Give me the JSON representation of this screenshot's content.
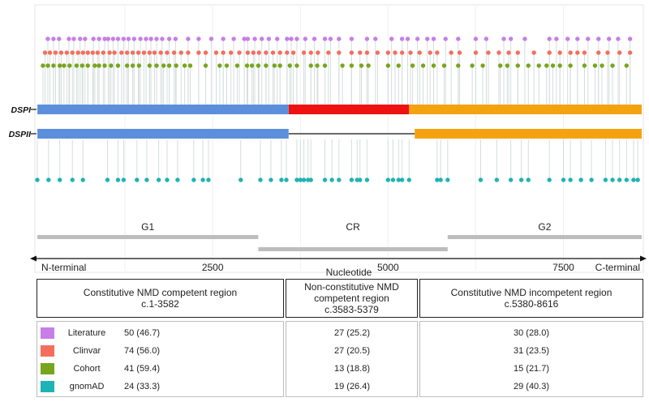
{
  "chart_data": {
    "type": "lollipop",
    "x_axis": {
      "label": "Nucleotide",
      "ticks": [
        2500,
        5000,
        7500
      ],
      "range": [
        0,
        8616
      ],
      "left_label": "N-terminal",
      "right_label": "C-terminal"
    },
    "isoforms": [
      {
        "name": "DSPI",
        "segments": [
          {
            "start": 1,
            "end": 3582,
            "color": "#5b8fdc"
          },
          {
            "start": 3583,
            "end": 5300,
            "color": "#ee1111"
          },
          {
            "start": 5300,
            "end": 8616,
            "color": "#f5a211"
          }
        ]
      },
      {
        "name": "DSPII",
        "segments": [
          {
            "start": 1,
            "end": 3582,
            "color": "#5b8fdc"
          },
          {
            "start": 5380,
            "end": 8616,
            "color": "#f5a211"
          }
        ],
        "gap": {
          "start": 3582,
          "end": 5380
        }
      }
    ],
    "regions": [
      {
        "name": "G1",
        "start": 0,
        "end": 3150
      },
      {
        "name": "CR",
        "start": 3150,
        "end": 5850
      },
      {
        "name": "G2",
        "start": 5850,
        "end": 8616
      }
    ],
    "series": [
      {
        "name": "Literature",
        "color": "#c77ee8",
        "positions": [
          150,
          230,
          310,
          450,
          520,
          610,
          680,
          800,
          880,
          960,
          1010,
          1080,
          1150,
          1230,
          1300,
          1380,
          1470,
          1550,
          1620,
          1700,
          1780,
          1880,
          1970,
          2150,
          2300,
          2480,
          2650,
          2800,
          2950,
          3000,
          3100,
          3200,
          3300,
          3420,
          3560,
          3620,
          3700,
          3820,
          3950,
          4100,
          4180,
          4300,
          4480,
          4700,
          4820,
          5050,
          5200,
          5280,
          5420,
          5560,
          5650,
          5820,
          6000,
          6250,
          6400,
          6650,
          6750,
          6950,
          7300,
          7400,
          7560,
          7700,
          7850,
          8000,
          8150,
          8280,
          8450
        ]
      },
      {
        "name": "Clinvar",
        "color": "#f46e5e",
        "positions": [
          110,
          180,
          260,
          340,
          420,
          500,
          580,
          650,
          720,
          790,
          860,
          940,
          1030,
          1100,
          1200,
          1280,
          1360,
          1440,
          1520,
          1600,
          1670,
          1760,
          1850,
          1950,
          2050,
          2150,
          2300,
          2400,
          2550,
          2650,
          2760,
          2880,
          3000,
          3080,
          3160,
          3260,
          3360,
          3460,
          3560,
          3650,
          3800,
          3900,
          4000,
          4150,
          4300,
          4480,
          4600,
          4700,
          4850,
          5000,
          5100,
          5200,
          5320,
          5450,
          5600,
          5700,
          5900,
          6020,
          6250,
          6430,
          6580,
          6720,
          6850,
          7080,
          7300,
          7450,
          7600,
          7700,
          7800,
          8000,
          8130,
          8300,
          8450
        ]
      },
      {
        "name": "Cohort",
        "color": "#78a51e",
        "positions": [
          80,
          150,
          230,
          320,
          380,
          460,
          560,
          640,
          720,
          820,
          880,
          960,
          1050,
          1150,
          1280,
          1360,
          1450,
          1600,
          1700,
          1800,
          1880,
          1980,
          2100,
          2180,
          2400,
          2600,
          2700,
          2850,
          2990,
          3060,
          3150,
          3260,
          3380,
          3460,
          3600,
          3700,
          3900,
          3990,
          4100,
          4350,
          4480,
          4620,
          4720,
          5000,
          5150,
          5350,
          5500,
          5650,
          5800,
          6000,
          6200,
          6350,
          6600,
          6700,
          6850,
          7000,
          7150,
          7260,
          7350,
          7450,
          7600,
          7800,
          7950,
          8050,
          8200,
          8400
        ]
      },
      {
        "name": "gnomAD",
        "color": "#1fb3b3",
        "positions": [
          0,
          160,
          320,
          500,
          650,
          1000,
          1150,
          1230,
          1420,
          1560,
          1730,
          1850,
          2000,
          2230,
          2360,
          2440,
          2900,
          3180,
          3330,
          3480,
          3550,
          3700,
          3750,
          3800,
          3860,
          3900,
          4100,
          4200,
          4300,
          4480,
          4560,
          4600,
          4700,
          5000,
          5070,
          5150,
          5200,
          5300,
          5700,
          5750,
          5850,
          6320,
          6550,
          6750,
          6900,
          7000,
          7300,
          7500,
          7600,
          7750,
          7900,
          8100,
          8200,
          8300,
          8400,
          8500,
          8560
        ]
      }
    ],
    "region_boxes": [
      {
        "title": "Constitutive NMD competent region",
        "range": "c.1-3582",
        "color": "#6a9ad8"
      },
      {
        "title_lines": [
          "Non-constitutive NMD",
          "competent region"
        ],
        "range": "c.3583-5379",
        "color": "#e0202a"
      },
      {
        "title": "Constitutive NMD incompetent region",
        "range": "c.5380-8616",
        "color": "#f2b233"
      }
    ],
    "table": {
      "rows": [
        {
          "label": "Literature",
          "color": "#c77ee8",
          "values": [
            "50 (46.7)",
            "27 (25.2)",
            "30 (28.0)"
          ]
        },
        {
          "label": "Clinvar",
          "color": "#f46e5e",
          "values": [
            "74 (56.0)",
            "27 (20.5)",
            "31 (23.5)"
          ]
        },
        {
          "label": "Cohort",
          "color": "#78a51e",
          "values": [
            "41 (59.4)",
            "13 (18.8)",
            "15 (21.7)"
          ]
        },
        {
          "label": "gnomAD",
          "color": "#1fb3b3",
          "values": [
            "24 (33.3)",
            "19 (26.4)",
            "29 (40.3)"
          ]
        }
      ]
    }
  }
}
